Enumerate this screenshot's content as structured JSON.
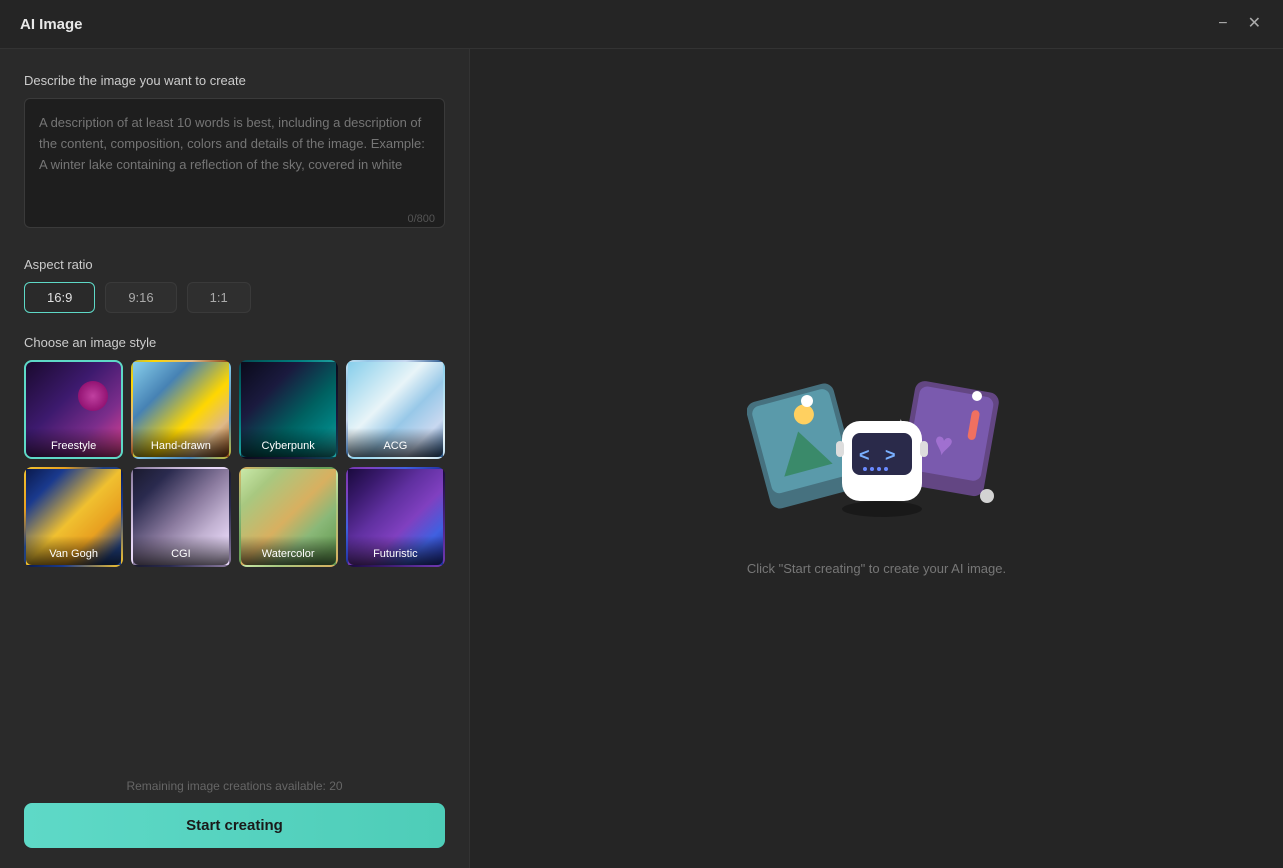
{
  "window": {
    "title": "AI Image"
  },
  "titlebar": {
    "minimize_label": "−",
    "close_label": "✕"
  },
  "left": {
    "description_label": "Describe the image you want to create",
    "description_placeholder": "A description of at least 10 words is best, including a description of the content, composition, colors and details of the image. Example: A winter lake containing a reflection of the sky, covered in white",
    "char_count": "0/800",
    "aspect_ratio_label": "Aspect ratio",
    "aspect_options": [
      {
        "id": "16-9",
        "label": "16:9",
        "active": true
      },
      {
        "id": "9-16",
        "label": "9:16",
        "active": false
      },
      {
        "id": "1-1",
        "label": "1:1",
        "active": false
      }
    ],
    "style_label": "Choose an image style",
    "styles": [
      {
        "id": "freestyle",
        "label": "Freestyle",
        "active": true,
        "css_class": "style-freestyle"
      },
      {
        "id": "hand-drawn",
        "label": "Hand-drawn",
        "active": false,
        "css_class": "style-handdrawn"
      },
      {
        "id": "cyberpunk",
        "label": "Cyberpunk",
        "active": false,
        "css_class": "style-cyberpunk"
      },
      {
        "id": "acg",
        "label": "ACG",
        "active": false,
        "css_class": "style-acg"
      },
      {
        "id": "van-gogh",
        "label": "Van Gogh",
        "active": false,
        "css_class": "style-vangogh"
      },
      {
        "id": "cgi",
        "label": "CGI",
        "active": false,
        "css_class": "style-cgi"
      },
      {
        "id": "watercolor",
        "label": "Watercolor",
        "active": false,
        "css_class": "style-watercolor"
      },
      {
        "id": "futuristic",
        "label": "Futuristic",
        "active": false,
        "css_class": "style-futuristic"
      }
    ],
    "remaining_text": "Remaining image creations available: 20",
    "start_button": "Start creating"
  },
  "right": {
    "prompt_hint": "Click \"Start creating\" to create your AI image."
  }
}
